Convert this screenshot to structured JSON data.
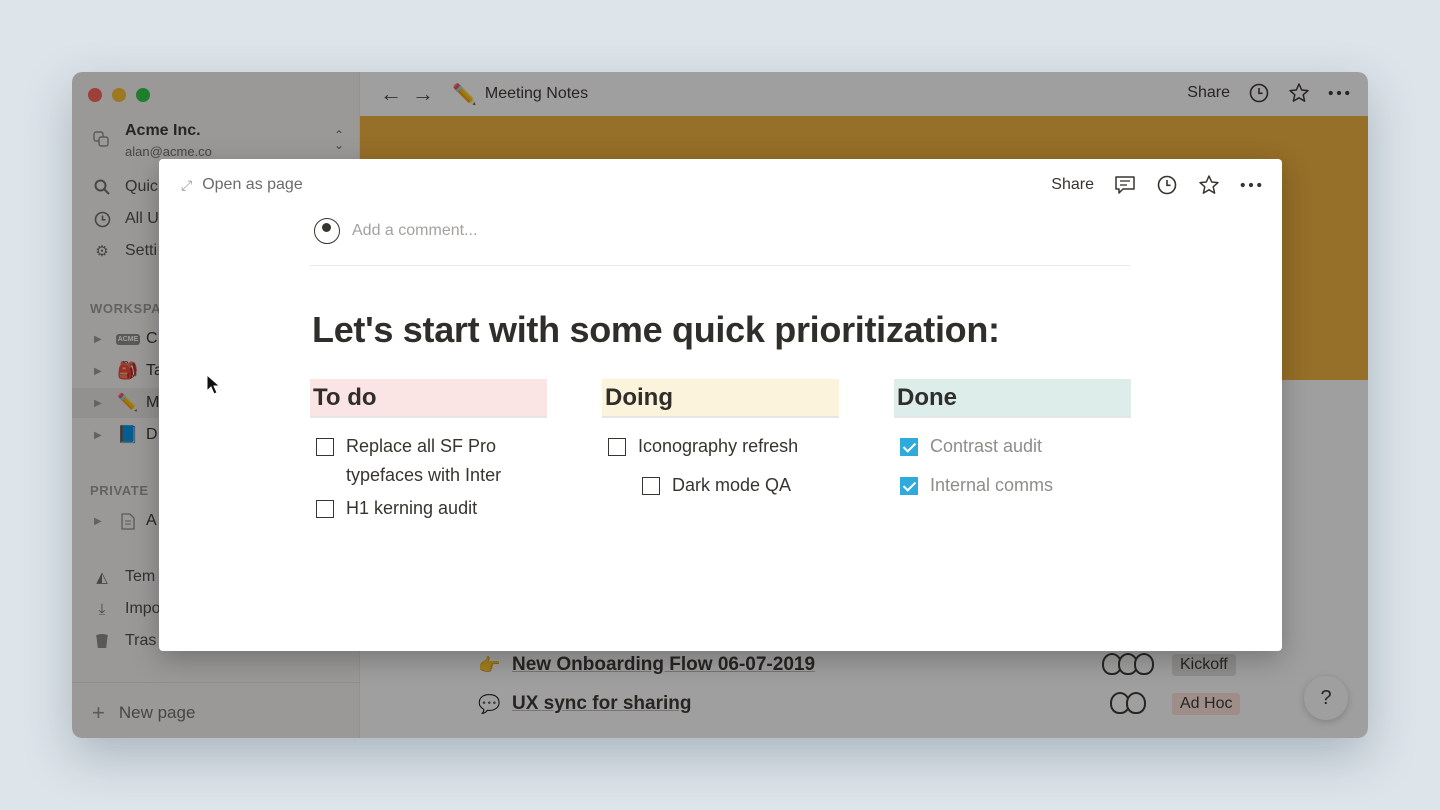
{
  "window": {
    "traffic_lights": [
      {
        "name": "close",
        "color": "#ff5f57"
      },
      {
        "name": "minimize",
        "color": "#febc2e"
      },
      {
        "name": "zoom",
        "color": "#28c840"
      }
    ]
  },
  "sidebar": {
    "workspace_name": "Acme Inc.",
    "workspace_email": "alan@acme.co",
    "items": [
      {
        "label": "Quic",
        "icon": "search-icon"
      },
      {
        "label": "All U",
        "icon": "clock-icon"
      },
      {
        "label": "Setti",
        "icon": "gear-icon"
      }
    ],
    "workspace_heading": "WORKSPA",
    "tree": [
      {
        "emoji": "ACME",
        "label": "C"
      },
      {
        "emoji": "🎒",
        "label": "Ta"
      },
      {
        "emoji": "✏️",
        "label": "M"
      },
      {
        "emoji": "📘",
        "label": "D"
      }
    ],
    "private_heading": "PRIVATE",
    "private_tree": [
      {
        "emoji": "📄",
        "label": "A"
      }
    ],
    "bottom_items": [
      {
        "label": "Tem",
        "icon": "shapes-icon"
      },
      {
        "label": "Impo",
        "icon": "download-icon"
      },
      {
        "label": "Tras",
        "icon": "trash-icon"
      }
    ],
    "new_page": "New page"
  },
  "topbar": {
    "page_emoji": "✏️",
    "page_title": "Meeting Notes",
    "share": "Share"
  },
  "background_rows": [
    {
      "emoji": "👉",
      "title": "New Onboarding Flow 06-07-2019",
      "tag": "Kickoff",
      "tag_color": "#e3e2e0"
    },
    {
      "emoji": "💬",
      "title": "UX sync for sharing",
      "tag": "Ad Hoc",
      "tag_color": "#ffe2dd"
    }
  ],
  "help_label": "?",
  "modal": {
    "open_as_page": "Open as page",
    "share": "Share",
    "comment_placeholder": "Add a comment...",
    "heading": "Let's start with some quick prioritization:",
    "columns": [
      {
        "title": "To do",
        "color": "#fbe4e4",
        "items": [
          {
            "text": "Replace all SF Pro typefaces with Inter",
            "checked": false
          },
          {
            "text": "H1 kerning audit",
            "checked": false
          }
        ]
      },
      {
        "title": "Doing",
        "color": "#fbf3db",
        "items": [
          {
            "text": "Iconography refresh",
            "checked": false
          },
          {
            "text": "Dark mode QA",
            "checked": false,
            "indent": true
          }
        ]
      },
      {
        "title": "Done",
        "color": "#ddedea",
        "items": [
          {
            "text": "Contrast audit",
            "checked": true
          },
          {
            "text": "Internal comms",
            "checked": true
          }
        ]
      }
    ]
  }
}
